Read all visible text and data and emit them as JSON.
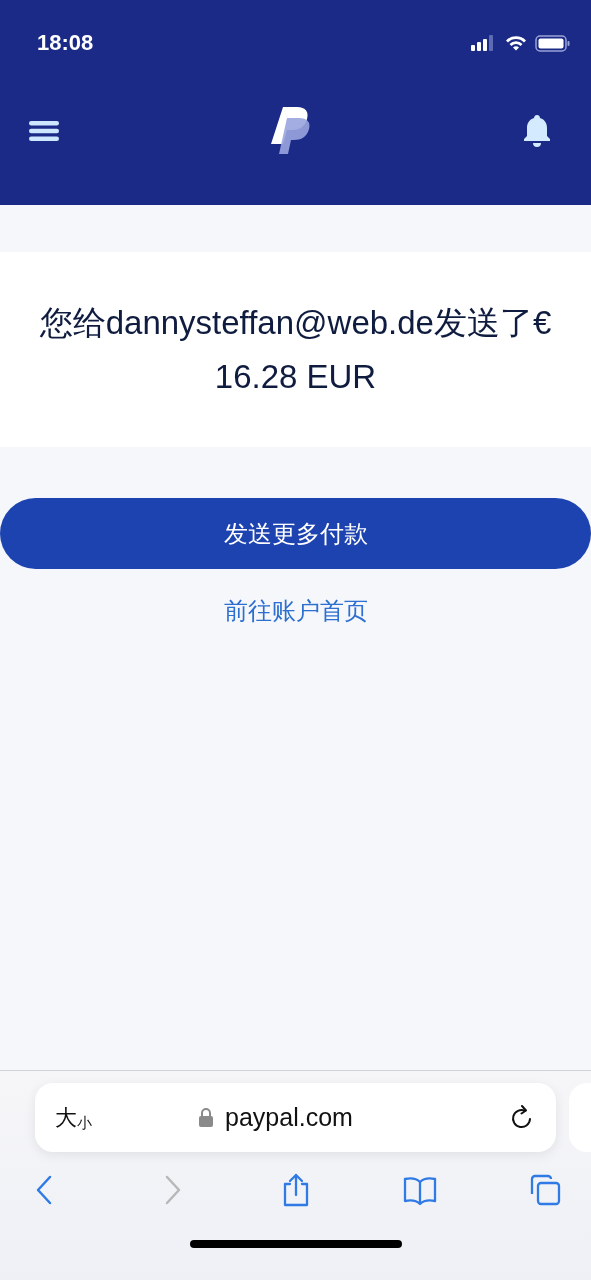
{
  "status_bar": {
    "time": "18:08"
  },
  "confirmation": {
    "message": "您给dannysteffan@web.de发送了€ 16.28 EUR"
  },
  "actions": {
    "primary_button": "发送更多付款",
    "link": "前往账户首页"
  },
  "browser": {
    "text_size": {
      "large": "大",
      "small": "小"
    },
    "url": "paypal.com",
    "nav": [
      {
        "kind": "back",
        "disabled": false
      },
      {
        "kind": "forward",
        "disabled": true
      },
      {
        "kind": "share",
        "disabled": false
      },
      {
        "kind": "bookmarks",
        "disabled": false
      },
      {
        "kind": "tabs",
        "disabled": false
      }
    ]
  }
}
